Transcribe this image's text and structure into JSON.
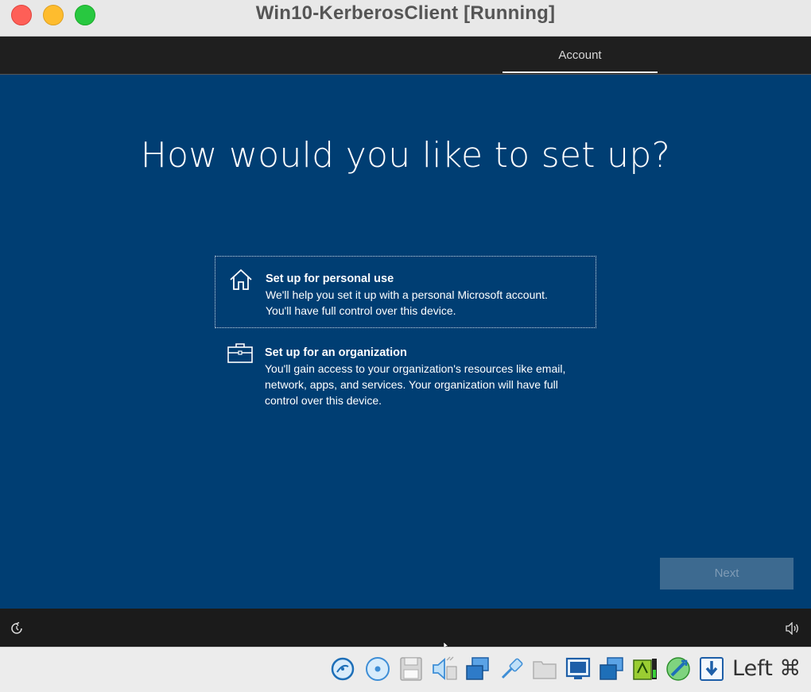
{
  "window": {
    "title": "Win10-KerberosClient [Running]"
  },
  "oobe": {
    "tabs": [
      {
        "label": "Account",
        "active": true
      }
    ],
    "heading": "How would you like to set up?",
    "options": [
      {
        "title": "Set up for personal use",
        "description": "We'll help you set it up with a personal Microsoft account.\nYou'll have full control over this device.",
        "icon": "home-icon",
        "selected": true
      },
      {
        "title": "Set up for an organization",
        "description": "You'll gain access to your organization's resources like email,\nnetwork, apps, and services. Your organization will have full\ncontrol over this device.",
        "icon": "briefcase-icon",
        "selected": false
      }
    ],
    "next_label": "Next",
    "next_enabled": false
  },
  "statusbar": {
    "host_key": "Left ⌘",
    "icons": [
      "hard-disk-icon",
      "optical-disk-icon",
      "floppy-icon",
      "audio-icon",
      "network-icon",
      "usb-icon",
      "shared-folder-icon",
      "display-icon",
      "capture-icon",
      "recording-icon",
      "cpu-activity-icon",
      "mouse-integration-icon",
      "host-key-icon"
    ]
  },
  "colors": {
    "oobe_background": "#003e73",
    "oobe_bar": "#1f1f1f",
    "next_disabled": "#3d6a90"
  }
}
